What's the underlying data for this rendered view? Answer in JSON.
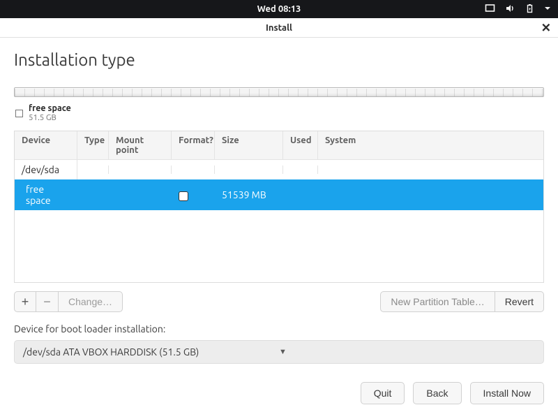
{
  "menubar": {
    "datetime": "Wed 08:13"
  },
  "dialog": {
    "title": "Install"
  },
  "page": {
    "heading": "Installation type"
  },
  "summary": {
    "label": "free space",
    "size": "51.5 GB"
  },
  "table": {
    "headers": {
      "device": "Device",
      "type": "Type",
      "mount": "Mount point",
      "format": "Format?",
      "size": "Size",
      "used": "Used",
      "system": "System"
    },
    "rows": [
      {
        "device": "/dev/sda",
        "type": "",
        "mount": "",
        "format": "",
        "size": "",
        "used": "",
        "system": "",
        "kind": "parent"
      },
      {
        "device": "free space",
        "type": "",
        "mount": "",
        "format": "checkbox",
        "size": "51539 MB",
        "used": "",
        "system": "",
        "kind": "selected"
      }
    ]
  },
  "actions": {
    "add": "+",
    "remove": "−",
    "change": "Change…",
    "new_table": "New Partition Table…",
    "revert": "Revert"
  },
  "bootloader": {
    "label": "Device for boot loader installation:",
    "selected": "/dev/sda ATA VBOX HARDDISK (51.5 GB)"
  },
  "footer": {
    "quit": "Quit",
    "back": "Back",
    "install": "Install Now"
  }
}
